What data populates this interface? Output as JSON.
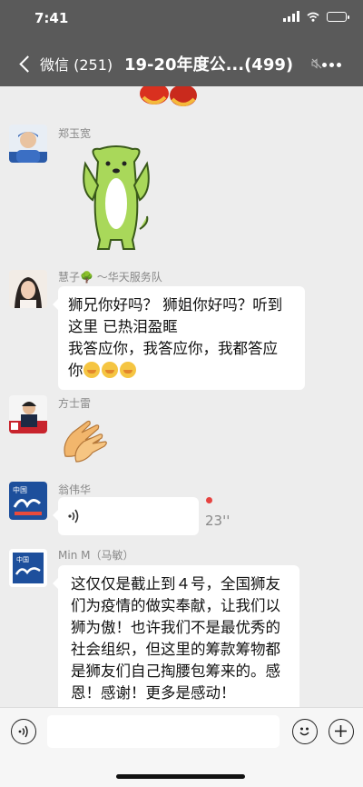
{
  "status": {
    "time": "7:41"
  },
  "nav": {
    "back_label": "微信 (251)",
    "title": "19-20年度公...(499)"
  },
  "messages": [
    {
      "sender": "郑玉宽",
      "type": "sticker",
      "sticker": "green-dog-sticker"
    },
    {
      "sender": "慧子🌳 ～华天服务队",
      "type": "text",
      "lines": [
        "狮兄你好吗？ 狮姐你好吗？听到",
        "这里 已热泪盈眶",
        "我答应你，我答应你，我都答应",
        "你"
      ]
    },
    {
      "sender": "方士雷",
      "type": "sticker",
      "sticker": "clapping-hands-sticker"
    },
    {
      "sender": "翁伟华",
      "type": "voice",
      "duration": "23''"
    },
    {
      "sender": "Min M（马敏）",
      "type": "text",
      "lines": [
        "这仅仅是截止到４号，全国狮友",
        "们为疫情的做实奉献，让我们以",
        "狮为傲！也许我们不是最优秀的",
        "社会组织，但这里的筹款筹物都",
        "是狮友们自己掏腰包筹来的。感",
        "恩！感谢！更多是感动！"
      ]
    }
  ],
  "input": {
    "placeholder": ""
  },
  "colors": {
    "header_bg": "#5a5a5a",
    "chat_bg": "#ededed",
    "bubble_bg": "#ffffff",
    "unread_dot": "#e64340"
  }
}
